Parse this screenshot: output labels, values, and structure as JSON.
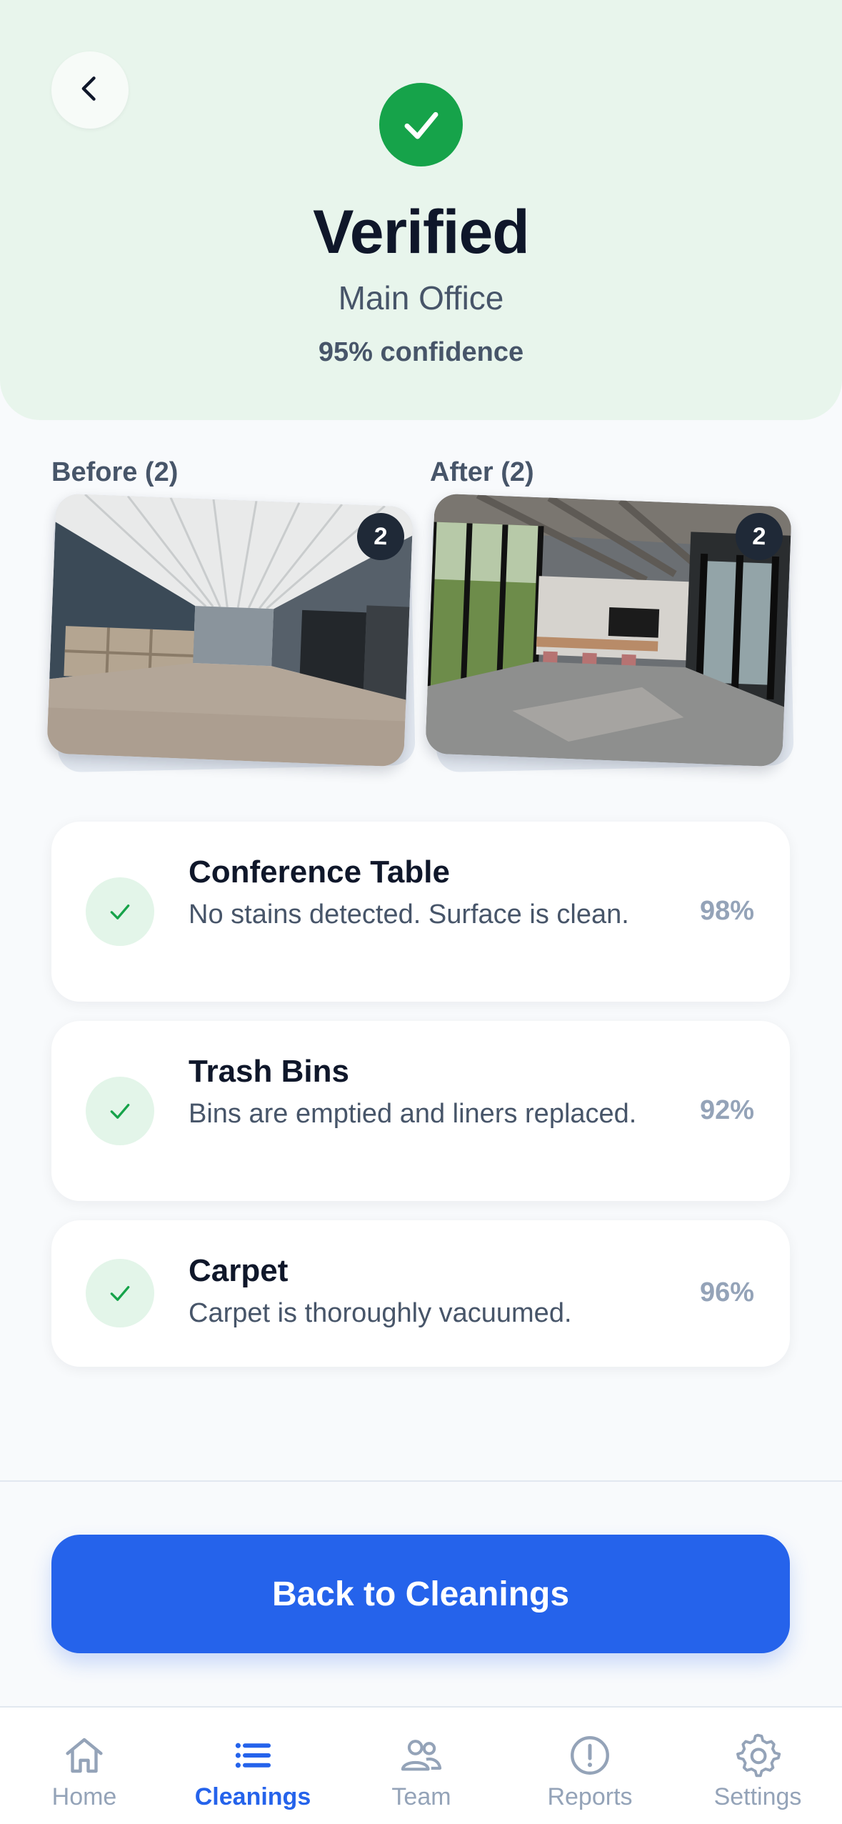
{
  "header": {
    "title": "Verified",
    "location": "Main Office",
    "confidence": "95% confidence"
  },
  "photos": {
    "before_label": "Before (2)",
    "after_label": "After (2)",
    "before_count": "2",
    "after_count": "2"
  },
  "checks": [
    {
      "name": "Conference Table",
      "description": "No stains detected. Surface is clean.",
      "score": "98%"
    },
    {
      "name": "Trash Bins",
      "description": "Bins are emptied and liners replaced.",
      "score": "92%"
    },
    {
      "name": "Carpet",
      "description": "Carpet is thoroughly vacuumed.",
      "score": "96%"
    }
  ],
  "primary_button": "Back to Cleanings",
  "tabs": [
    {
      "label": "Home",
      "icon": "home-icon",
      "active": false
    },
    {
      "label": "Cleanings",
      "icon": "list-icon",
      "active": true
    },
    {
      "label": "Team",
      "icon": "team-icon",
      "active": false
    },
    {
      "label": "Reports",
      "icon": "alert-icon",
      "active": false
    },
    {
      "label": "Settings",
      "icon": "gear-icon",
      "active": false
    }
  ],
  "colors": {
    "header_bg": "#e8f5ec",
    "success": "#16a34a",
    "primary": "#2563eb",
    "muted": "#94a3b8",
    "text": "#0f172a"
  }
}
